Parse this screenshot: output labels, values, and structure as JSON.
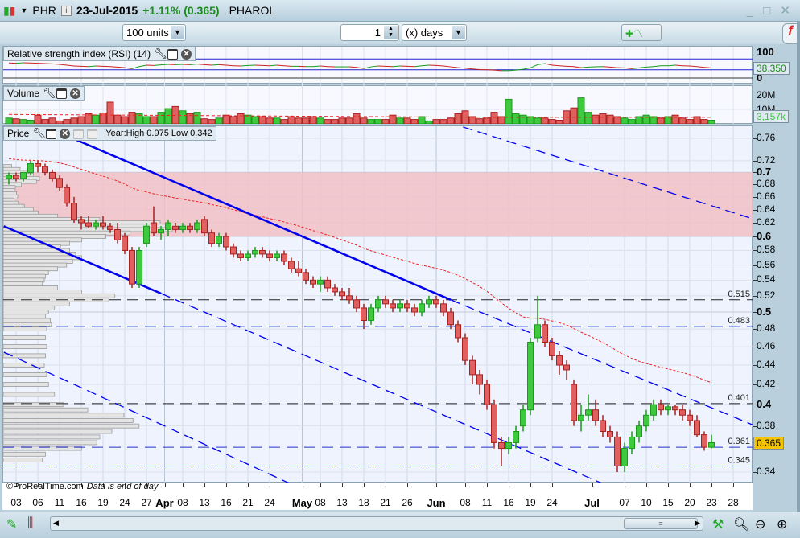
{
  "header": {
    "symbol": "PHR",
    "date": "23-Jul-2015",
    "change": "+1.11% (0.365)",
    "name": "PHAROL",
    "window_controls": "_ □ ✕"
  },
  "toolbar": {
    "units": "100 units",
    "period_value": "1",
    "period_unit": "(x) days"
  },
  "rsi": {
    "label": "Relative strength index (RSI) (14)",
    "value": "38.350",
    "axis": [
      "100",
      "0"
    ],
    "values": [
      55,
      54,
      56,
      55,
      54,
      53,
      52,
      50,
      47,
      44,
      43,
      42,
      44,
      43,
      42,
      40,
      38,
      34,
      42,
      47,
      46,
      48,
      50,
      49,
      50,
      49,
      51,
      49,
      47,
      49,
      47,
      45,
      44,
      46,
      47,
      46,
      45,
      47,
      45,
      43,
      43,
      42,
      42,
      44,
      42,
      41,
      41,
      41,
      39,
      35,
      41,
      44,
      43,
      42,
      44,
      43,
      42,
      45,
      47,
      46,
      44,
      41,
      38,
      36,
      33,
      31,
      30,
      29,
      27,
      27,
      29,
      32,
      37,
      49,
      53,
      47,
      45,
      43,
      42,
      38,
      40,
      41,
      42,
      40,
      38,
      37,
      34,
      37,
      40,
      42,
      45,
      45,
      47,
      45,
      44,
      42,
      39,
      37,
      38
    ]
  },
  "volume": {
    "label": "Volume",
    "value": "3,157k",
    "axis": [
      "20M",
      "10M"
    ],
    "values": [
      4,
      3.5,
      3,
      2.5,
      6,
      3,
      4,
      2,
      3,
      4,
      5,
      7,
      6,
      7.5,
      15,
      6,
      5,
      8,
      7,
      5,
      5,
      8,
      10.5,
      12,
      9,
      7,
      8,
      3.5,
      3,
      4,
      6,
      5,
      7,
      6,
      5,
      5,
      4,
      4,
      3,
      5,
      4,
      4,
      5,
      4,
      3,
      3,
      4,
      4,
      7,
      4,
      3,
      3,
      3,
      6,
      4,
      4,
      3,
      5,
      2,
      3,
      3,
      4,
      7,
      9,
      5,
      3.5,
      4,
      8,
      5,
      17,
      7,
      6,
      5,
      4,
      4,
      3,
      2.5,
      9,
      11,
      18,
      8,
      6,
      7,
      6,
      5,
      4,
      3,
      5,
      6,
      5,
      4,
      5,
      6,
      4,
      3,
      5,
      3,
      2.5,
      3.2
    ]
  },
  "price": {
    "label": "Price",
    "year_info": "Year:High 0.975 Low 0.342",
    "last": "0.365",
    "levels": [
      {
        "value": 0.515,
        "label": "0.515"
      },
      {
        "value": 0.483,
        "label": "0.483"
      },
      {
        "value": 0.401,
        "label": "0.401"
      },
      {
        "value": 0.361,
        "label": "0.361"
      },
      {
        "value": 0.345,
        "label": "0.345"
      }
    ],
    "zone": [
      0.6,
      0.7
    ],
    "axis": [
      {
        "v": 0.76,
        "t": "0.76"
      },
      {
        "v": 0.72,
        "t": "0.72"
      },
      {
        "v": 0.7,
        "t": "0.7",
        "b": 1
      },
      {
        "v": 0.68,
        "t": "0.68"
      },
      {
        "v": 0.66,
        "t": "0.66"
      },
      {
        "v": 0.64,
        "t": "0.64"
      },
      {
        "v": 0.62,
        "t": "0.62"
      },
      {
        "v": 0.6,
        "t": "0.6",
        "b": 1
      },
      {
        "v": 0.58,
        "t": "0.58"
      },
      {
        "v": 0.56,
        "t": "0.56"
      },
      {
        "v": 0.54,
        "t": "0.54"
      },
      {
        "v": 0.52,
        "t": "0.52"
      },
      {
        "v": 0.5,
        "t": "0.5",
        "b": 1
      },
      {
        "v": 0.48,
        "t": "0.48"
      },
      {
        "v": 0.46,
        "t": "0.46"
      },
      {
        "v": 0.44,
        "t": "0.44"
      },
      {
        "v": 0.42,
        "t": "0.42"
      },
      {
        "v": 0.4,
        "t": "0.4",
        "b": 1
      },
      {
        "v": 0.38,
        "t": "0.38"
      },
      {
        "v": 0.34,
        "t": "0.34"
      }
    ],
    "trendlines": [
      {
        "style": "solid",
        "p1": [
          8.8,
          0.76
        ],
        "p2": [
          61,
          0.515
        ]
      },
      {
        "style": "dashed",
        "p1": [
          61,
          0.515
        ],
        "p2": [
          102.7,
          0.381
        ]
      },
      {
        "style": "solid",
        "p1": [
          -0.7,
          0.615
        ],
        "p2": [
          21,
          0.523
        ]
      },
      {
        "style": "dashed",
        "p1": [
          21,
          0.523
        ],
        "p2": [
          84.3,
          0.325
        ]
      },
      {
        "style": "dashed",
        "p1": [
          62.7,
          0.781
        ],
        "p2": [
          102.7,
          0.626
        ]
      },
      {
        "style": "dashed",
        "p1": [
          -0.7,
          0.454
        ],
        "p2": [
          41,
          0.325
        ]
      }
    ],
    "volume_profile": [
      [
        0.71,
        14
      ],
      [
        0.705,
        28
      ],
      [
        0.7,
        42
      ],
      [
        0.695,
        50
      ],
      [
        0.69,
        60
      ],
      [
        0.685,
        55
      ],
      [
        0.68,
        30
      ],
      [
        0.675,
        20
      ],
      [
        0.67,
        18
      ],
      [
        0.665,
        22
      ],
      [
        0.66,
        24
      ],
      [
        0.655,
        18
      ],
      [
        0.65,
        25
      ],
      [
        0.645,
        35
      ],
      [
        0.64,
        50
      ],
      [
        0.635,
        58
      ],
      [
        0.63,
        90
      ],
      [
        0.625,
        160
      ],
      [
        0.62,
        260
      ],
      [
        0.615,
        300
      ],
      [
        0.61,
        280
      ],
      [
        0.605,
        210
      ],
      [
        0.6,
        170
      ],
      [
        0.595,
        130
      ],
      [
        0.59,
        110
      ],
      [
        0.585,
        95
      ],
      [
        0.58,
        110
      ],
      [
        0.575,
        120
      ],
      [
        0.57,
        130
      ],
      [
        0.565,
        115
      ],
      [
        0.56,
        105
      ],
      [
        0.555,
        90
      ],
      [
        0.55,
        75
      ],
      [
        0.545,
        70
      ],
      [
        0.54,
        68
      ],
      [
        0.535,
        65
      ],
      [
        0.53,
        90
      ],
      [
        0.525,
        130
      ],
      [
        0.52,
        185
      ],
      [
        0.515,
        175
      ],
      [
        0.51,
        110
      ],
      [
        0.505,
        85
      ],
      [
        0.5,
        75
      ],
      [
        0.495,
        70
      ],
      [
        0.49,
        78
      ],
      [
        0.485,
        80
      ],
      [
        0.48,
        72
      ],
      [
        0.47,
        70
      ],
      [
        0.46,
        72
      ],
      [
        0.45,
        70
      ],
      [
        0.44,
        68
      ],
      [
        0.43,
        72
      ],
      [
        0.42,
        75
      ],
      [
        0.41,
        85
      ],
      [
        0.4,
        100
      ],
      [
        0.395,
        140
      ],
      [
        0.39,
        200
      ],
      [
        0.385,
        215
      ],
      [
        0.38,
        225
      ],
      [
        0.375,
        180
      ],
      [
        0.37,
        160
      ],
      [
        0.365,
        155
      ],
      [
        0.36,
        130
      ],
      [
        0.355,
        70
      ],
      [
        0.35,
        65
      ]
    ],
    "candles": [
      [
        0.69,
        0.7,
        0.68,
        0.695
      ],
      [
        0.695,
        0.7,
        0.685,
        0.69
      ],
      [
        0.69,
        0.7,
        0.685,
        0.7
      ],
      [
        0.7,
        0.72,
        0.695,
        0.715
      ],
      [
        0.715,
        0.72,
        0.7,
        0.71
      ],
      [
        0.71,
        0.715,
        0.695,
        0.7
      ],
      [
        0.7,
        0.705,
        0.685,
        0.69
      ],
      [
        0.69,
        0.695,
        0.67,
        0.675
      ],
      [
        0.675,
        0.68,
        0.645,
        0.65
      ],
      [
        0.65,
        0.66,
        0.62,
        0.625
      ],
      [
        0.625,
        0.63,
        0.61,
        0.62
      ],
      [
        0.62,
        0.63,
        0.612,
        0.615
      ],
      [
        0.615,
        0.625,
        0.61,
        0.62
      ],
      [
        0.62,
        0.63,
        0.61,
        0.615
      ],
      [
        0.615,
        0.62,
        0.605,
        0.61
      ],
      [
        0.61,
        0.62,
        0.59,
        0.595
      ],
      [
        0.6,
        0.605,
        0.575,
        0.58
      ],
      [
        0.58,
        0.585,
        0.53,
        0.535
      ],
      [
        0.535,
        0.585,
        0.53,
        0.58
      ],
      [
        0.59,
        0.62,
        0.585,
        0.615
      ],
      [
        0.62,
        0.645,
        0.6,
        0.605
      ],
      [
        0.605,
        0.615,
        0.595,
        0.61
      ],
      [
        0.61,
        0.625,
        0.6,
        0.62
      ],
      [
        0.615,
        0.62,
        0.605,
        0.61
      ],
      [
        0.61,
        0.62,
        0.605,
        0.615
      ],
      [
        0.615,
        0.62,
        0.605,
        0.61
      ],
      [
        0.61,
        0.625,
        0.605,
        0.62
      ],
      [
        0.625,
        0.63,
        0.6,
        0.605
      ],
      [
        0.605,
        0.61,
        0.585,
        0.59
      ],
      [
        0.59,
        0.605,
        0.585,
        0.6
      ],
      [
        0.6,
        0.605,
        0.58,
        0.585
      ],
      [
        0.585,
        0.59,
        0.57,
        0.575
      ],
      [
        0.575,
        0.58,
        0.565,
        0.57
      ],
      [
        0.57,
        0.58,
        0.565,
        0.575
      ],
      [
        0.575,
        0.585,
        0.57,
        0.58
      ],
      [
        0.58,
        0.585,
        0.57,
        0.575
      ],
      [
        0.575,
        0.58,
        0.565,
        0.57
      ],
      [
        0.57,
        0.58,
        0.565,
        0.575
      ],
      [
        0.575,
        0.58,
        0.56,
        0.565
      ],
      [
        0.565,
        0.57,
        0.55,
        0.555
      ],
      [
        0.555,
        0.565,
        0.545,
        0.55
      ],
      [
        0.55,
        0.555,
        0.535,
        0.54
      ],
      [
        0.54,
        0.545,
        0.53,
        0.535
      ],
      [
        0.535,
        0.545,
        0.525,
        0.54
      ],
      [
        0.54,
        0.545,
        0.525,
        0.53
      ],
      [
        0.53,
        0.535,
        0.52,
        0.525
      ],
      [
        0.525,
        0.53,
        0.515,
        0.52
      ],
      [
        0.52,
        0.53,
        0.51,
        0.515
      ],
      [
        0.515,
        0.52,
        0.5,
        0.505
      ],
      [
        0.505,
        0.51,
        0.48,
        0.49
      ],
      [
        0.49,
        0.51,
        0.485,
        0.505
      ],
      [
        0.505,
        0.52,
        0.5,
        0.515
      ],
      [
        0.515,
        0.52,
        0.505,
        0.51
      ],
      [
        0.51,
        0.515,
        0.5,
        0.505
      ],
      [
        0.505,
        0.515,
        0.5,
        0.51
      ],
      [
        0.51,
        0.515,
        0.5,
        0.505
      ],
      [
        0.505,
        0.51,
        0.495,
        0.5
      ],
      [
        0.5,
        0.515,
        0.495,
        0.51
      ],
      [
        0.51,
        0.52,
        0.505,
        0.515
      ],
      [
        0.515,
        0.52,
        0.505,
        0.51
      ],
      [
        0.51,
        0.515,
        0.495,
        0.5
      ],
      [
        0.5,
        0.505,
        0.48,
        0.485
      ],
      [
        0.485,
        0.49,
        0.465,
        0.47
      ],
      [
        0.47,
        0.475,
        0.44,
        0.445
      ],
      [
        0.445,
        0.45,
        0.42,
        0.43
      ],
      [
        0.43,
        0.435,
        0.41,
        0.42
      ],
      [
        0.42,
        0.425,
        0.395,
        0.4
      ],
      [
        0.4,
        0.405,
        0.36,
        0.365
      ],
      [
        0.365,
        0.37,
        0.345,
        0.36
      ],
      [
        0.36,
        0.37,
        0.355,
        0.365
      ],
      [
        0.365,
        0.38,
        0.36,
        0.375
      ],
      [
        0.38,
        0.4,
        0.375,
        0.395
      ],
      [
        0.395,
        0.47,
        0.39,
        0.465
      ],
      [
        0.47,
        0.52,
        0.465,
        0.485
      ],
      [
        0.485,
        0.49,
        0.46,
        0.465
      ],
      [
        0.465,
        0.47,
        0.445,
        0.45
      ],
      [
        0.45,
        0.455,
        0.43,
        0.44
      ],
      [
        0.44,
        0.445,
        0.425,
        0.435
      ],
      [
        0.42,
        0.425,
        0.38,
        0.385
      ],
      [
        0.385,
        0.4,
        0.375,
        0.39
      ],
      [
        0.39,
        0.41,
        0.385,
        0.395
      ],
      [
        0.395,
        0.405,
        0.38,
        0.385
      ],
      [
        0.385,
        0.39,
        0.37,
        0.375
      ],
      [
        0.375,
        0.38,
        0.365,
        0.37
      ],
      [
        0.37,
        0.375,
        0.34,
        0.345
      ],
      [
        0.345,
        0.365,
        0.34,
        0.36
      ],
      [
        0.36,
        0.375,
        0.355,
        0.37
      ],
      [
        0.37,
        0.385,
        0.365,
        0.38
      ],
      [
        0.38,
        0.395,
        0.375,
        0.39
      ],
      [
        0.39,
        0.405,
        0.385,
        0.4
      ],
      [
        0.4,
        0.405,
        0.39,
        0.395
      ],
      [
        0.395,
        0.4,
        0.39,
        0.398
      ],
      [
        0.398,
        0.4,
        0.39,
        0.395
      ],
      [
        0.395,
        0.4,
        0.385,
        0.39
      ],
      [
        0.39,
        0.395,
        0.38,
        0.385
      ],
      [
        0.385,
        0.39,
        0.37,
        0.372
      ],
      [
        0.372,
        0.375,
        0.358,
        0.361
      ],
      [
        0.361,
        0.372,
        0.36,
        0.365
      ]
    ]
  },
  "xaxis": [
    {
      "t": "03",
      "i": 1
    },
    {
      "t": "06",
      "i": 4
    },
    {
      "t": "11",
      "i": 7
    },
    {
      "t": "16",
      "i": 10
    },
    {
      "t": "19",
      "i": 13
    },
    {
      "t": "24",
      "i": 16
    },
    {
      "t": "27",
      "i": 19
    },
    {
      "t": "Apr",
      "i": 21.5,
      "b": 1
    },
    {
      "t": "08",
      "i": 24
    },
    {
      "t": "13",
      "i": 27
    },
    {
      "t": "16",
      "i": 30
    },
    {
      "t": "21",
      "i": 33
    },
    {
      "t": "24",
      "i": 36
    },
    {
      "t": "May",
      "i": 40.5,
      "b": 1
    },
    {
      "t": "08",
      "i": 43
    },
    {
      "t": "13",
      "i": 46
    },
    {
      "t": "18",
      "i": 49
    },
    {
      "t": "21",
      "i": 52
    },
    {
      "t": "26",
      "i": 55
    },
    {
      "t": "Jun",
      "i": 59,
      "b": 1
    },
    {
      "t": "08",
      "i": 63
    },
    {
      "t": "11",
      "i": 66
    },
    {
      "t": "16",
      "i": 69
    },
    {
      "t": "19",
      "i": 72
    },
    {
      "t": "24",
      "i": 75
    },
    {
      "t": "Jul",
      "i": 80.5,
      "b": 1
    },
    {
      "t": "07",
      "i": 85
    },
    {
      "t": "10",
      "i": 88
    },
    {
      "t": "15",
      "i": 91
    },
    {
      "t": "20",
      "i": 94
    },
    {
      "t": "23",
      "i": 97
    },
    {
      "t": "28",
      "i": 100
    }
  ],
  "footer": {
    "copyright": "©ProRealTime.com",
    "note": "Data is end of day"
  },
  "colors": {
    "up": "#3ec93e",
    "down": "#e06060",
    "trend": "#0000ee",
    "zone": "#f0c0c6"
  }
}
